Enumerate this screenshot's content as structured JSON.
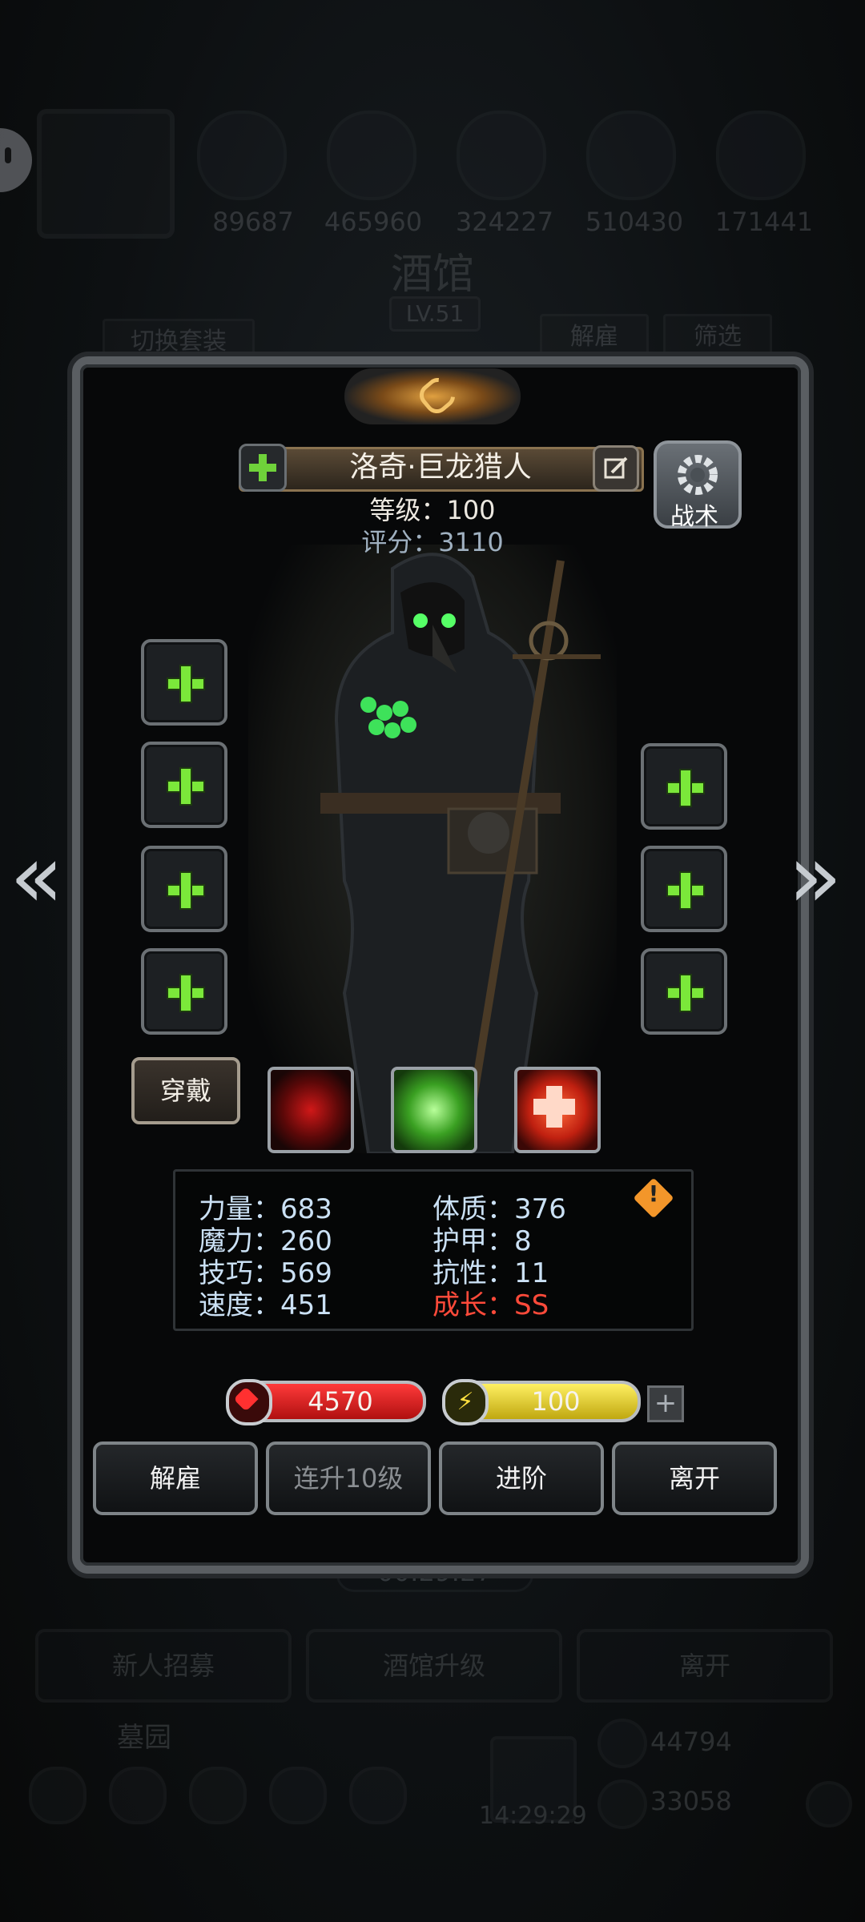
{
  "top_resources": [
    {
      "icon": "ore-icon",
      "value": "89687"
    },
    {
      "icon": "wood-icon",
      "value": "465960"
    },
    {
      "icon": "stone-icon",
      "value": "324227"
    },
    {
      "icon": "crystal-icon",
      "value": "510430"
    },
    {
      "icon": "iron-icon",
      "value": "171441"
    }
  ],
  "tavern": {
    "title": "酒馆",
    "level": "LV.51",
    "switch_outfit": "切换套装",
    "dismiss": "解雇",
    "filter": "筛选",
    "timer": "00:29:27",
    "recruit": "新人招募",
    "upgrade": "酒馆升级",
    "leave": "离开",
    "cemetery": "墓园",
    "bottom_timer": "14:29:29",
    "gold": "44794",
    "gems": "33058"
  },
  "hero": {
    "name": "洛奇·巨龙猎人",
    "level_text": "等级：100",
    "score_text": "评分：3110",
    "tactics": "战术",
    "wear": "穿戴"
  },
  "stats": {
    "left": [
      "力量：683",
      "魔力：260",
      "技巧：569",
      "速度：451"
    ],
    "right": [
      "体质：376",
      "护甲：8",
      "抗性：11"
    ],
    "growth": "成长：SS",
    "warning": "!"
  },
  "bars": {
    "hp": "4570",
    "energy": "100"
  },
  "actions": {
    "dismiss": "解雇",
    "level10": "连升10级",
    "advance": "进阶",
    "leave": "离开"
  },
  "colors": {
    "accent_green": "#7be83a",
    "hp_red": "#d01c1c",
    "energy_yellow": "#e3d21a",
    "growth_red": "#ff4a3a"
  }
}
